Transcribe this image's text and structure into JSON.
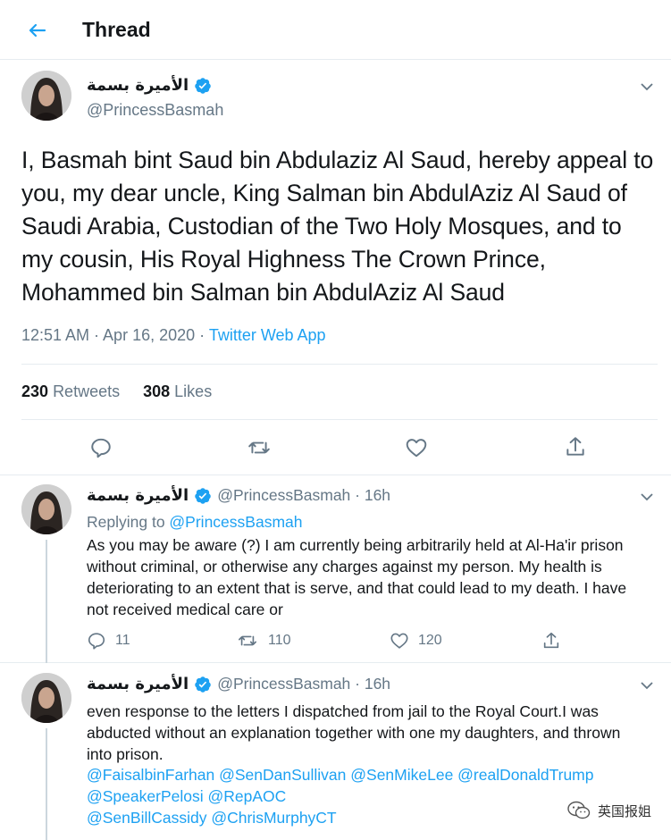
{
  "header": {
    "title": "Thread"
  },
  "author": {
    "name": "الأميرة بسمة",
    "handle": "@PrincessBasmah"
  },
  "main_tweet": {
    "text": "I, Basmah bint Saud bin Abdulaziz Al Saud, hereby appeal to you, my dear uncle, King Salman bin AbdulAziz Al Saud of Saudi Arabia, Custodian of the Two Holy Mosques, and to my cousin, His Royal Highness The Crown Prince, Mohammed bin Salman bin AbdulAziz Al Saud",
    "time": "12:51 AM · Apr 16, 2020 · ",
    "source": "Twitter Web App",
    "retweets_count": "230",
    "retweets_label": "Retweets",
    "likes_count": "308",
    "likes_label": "Likes"
  },
  "reply1": {
    "handle_time": "@PrincessBasmah · 16h",
    "replying_prefix": "Replying to ",
    "replying_to": "@PrincessBasmah",
    "text": "As you may be aware (?) I am currently being arbitrarily held at Al-Ha'ir prison without criminal, or otherwise any charges against my person. My health is deteriorating to an extent that is serve, and that could lead to my death. I have not received medical care or",
    "reply_count": "11",
    "retweet_count": "110",
    "like_count": "120"
  },
  "reply2": {
    "handle_time": "@PrincessBasmah · 16h",
    "text": "even response to the letters I dispatched from jail to the Royal Court.I was abducted without an explanation together with one my daughters, and thrown into prison.",
    "mentions_line1": "@FaisalbinFarhan @SenDanSullivan @SenMikeLee @realDonaldTrump",
    "mentions_line2": "@SpeakerPelosi @RepAOC",
    "mentions_line3": "@SenBillCassidy @ChrisMurphyCT"
  },
  "watermark": {
    "text": "英国报姐"
  },
  "colors": {
    "accent": "#1da1f2",
    "muted": "#657786",
    "text": "#14171a",
    "border": "#e6ecf0"
  }
}
